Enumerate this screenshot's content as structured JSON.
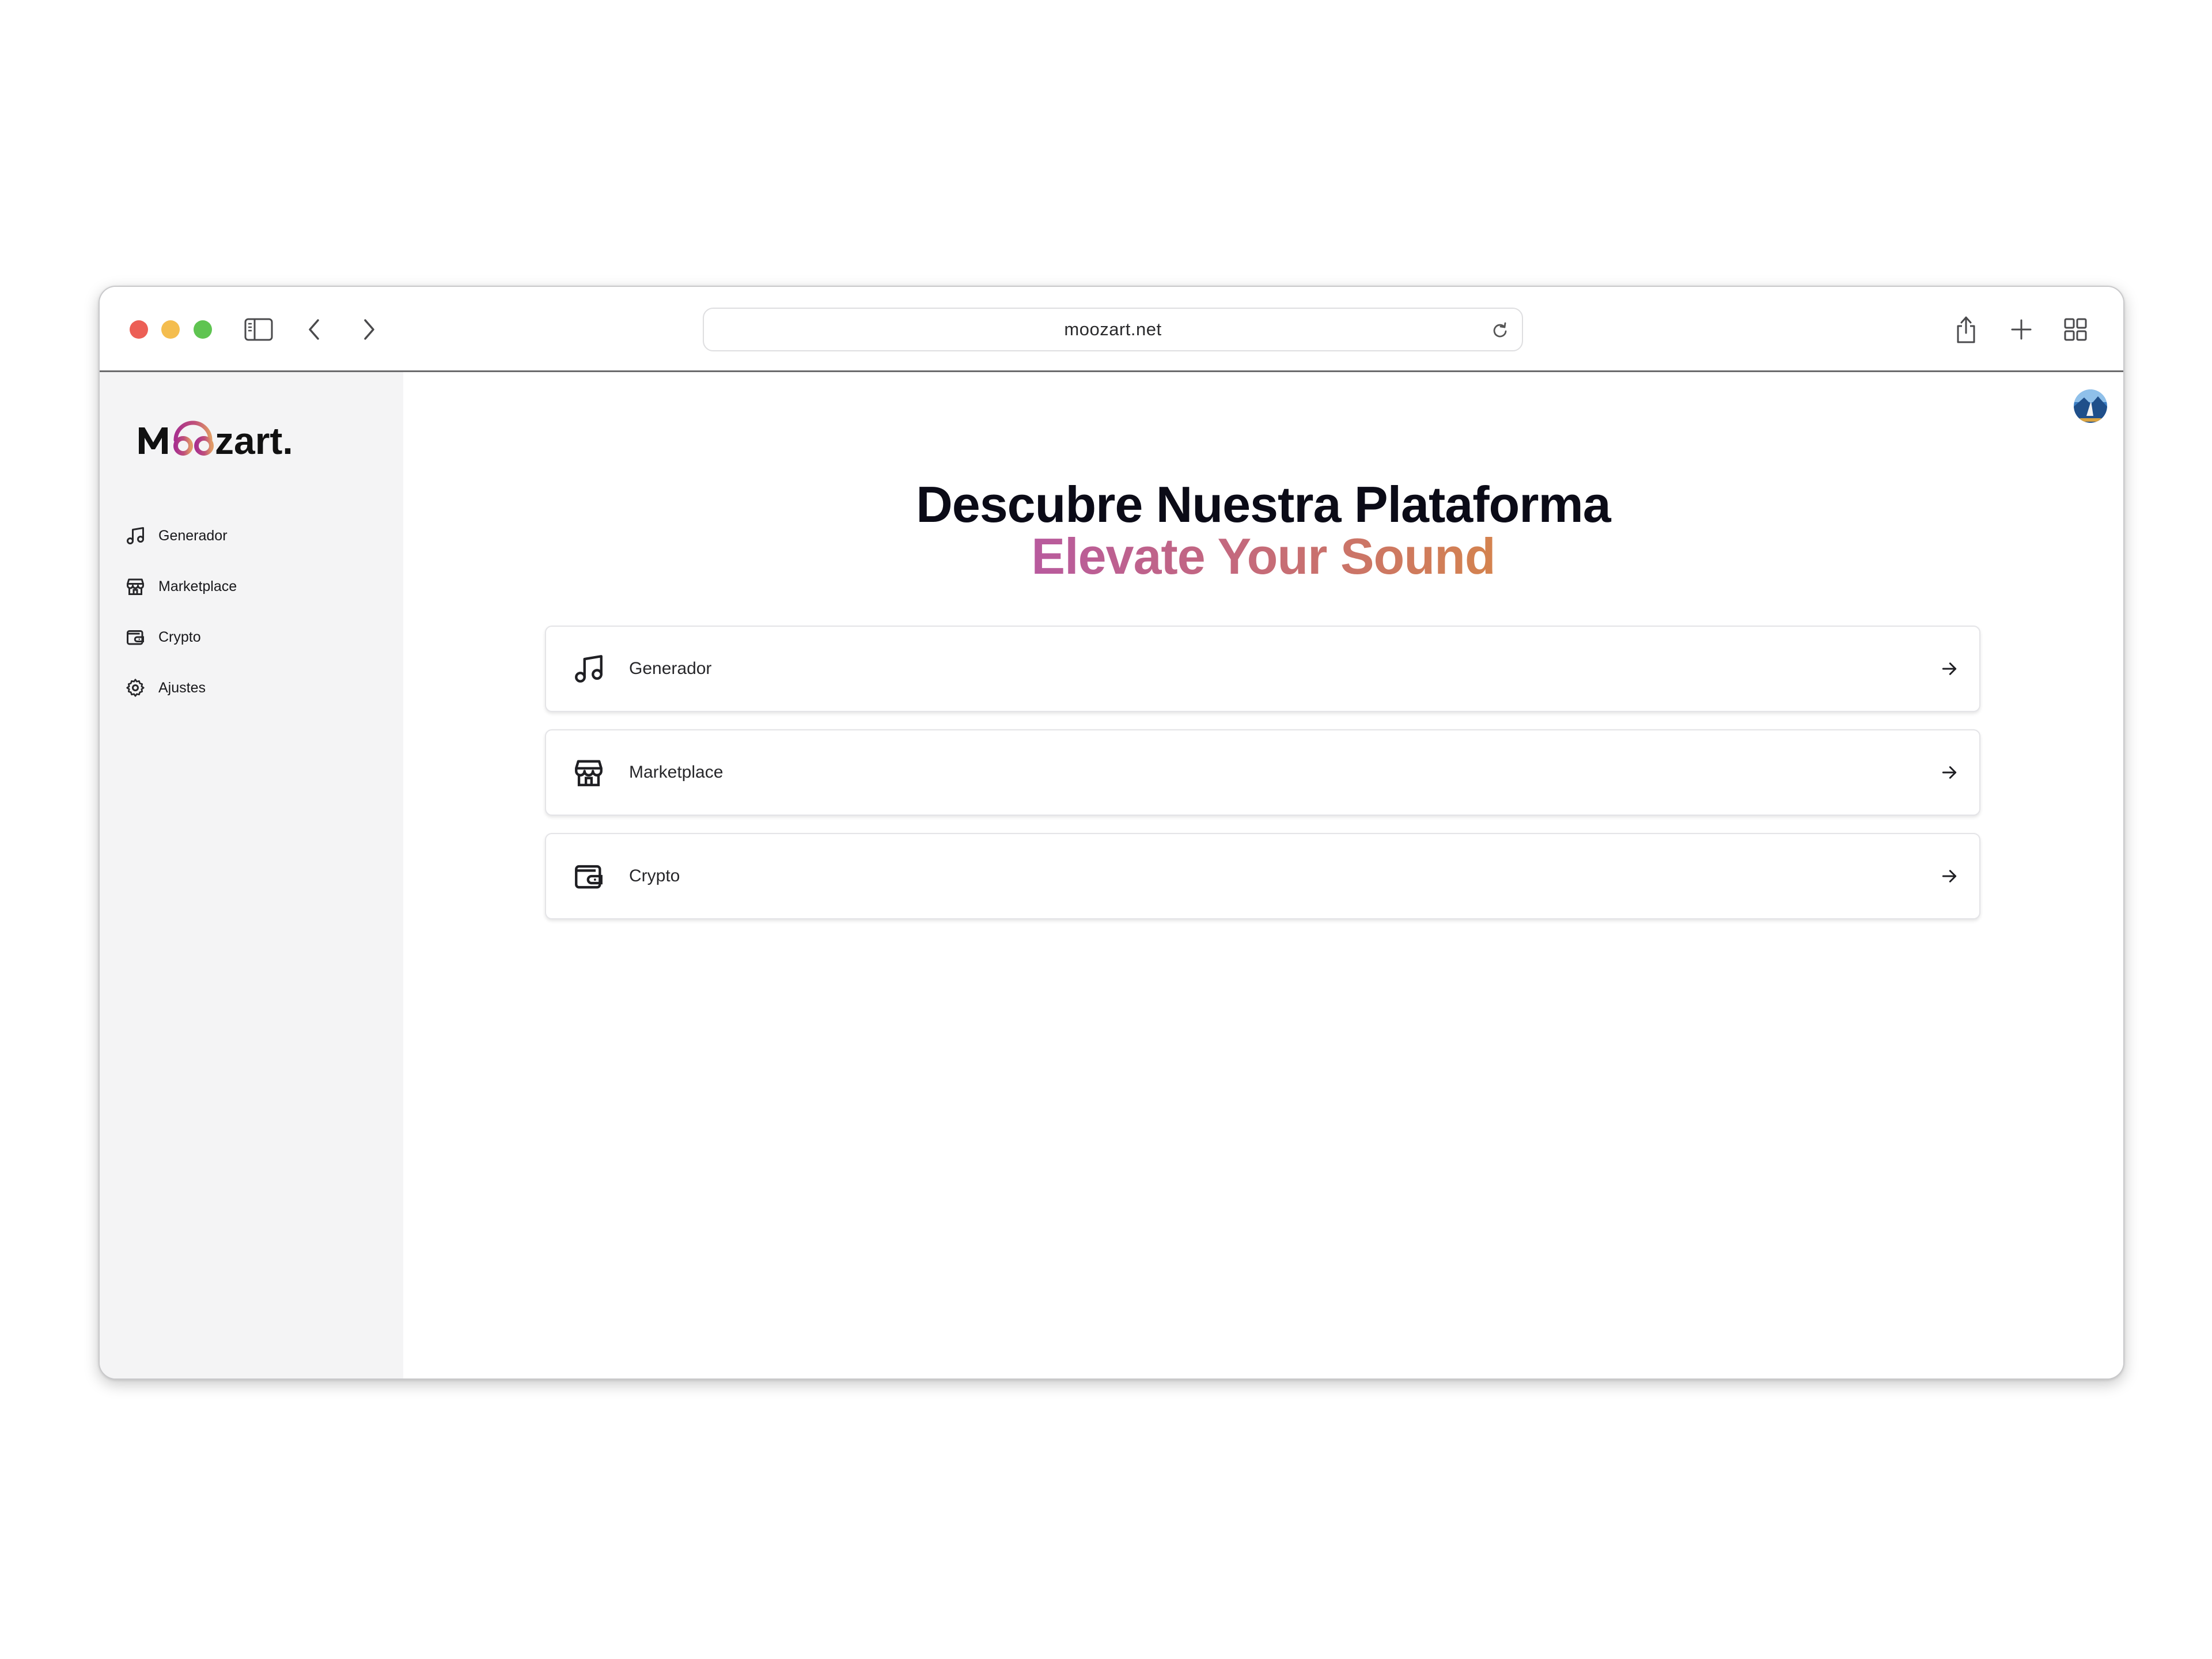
{
  "browser": {
    "url": "moozart.net"
  },
  "sidebar": {
    "logo_text": "Moozart.",
    "items": [
      {
        "label": "Generador",
        "icon": "music-note-icon"
      },
      {
        "label": "Marketplace",
        "icon": "store-icon"
      },
      {
        "label": "Crypto",
        "icon": "wallet-icon"
      },
      {
        "label": "Ajustes",
        "icon": "gear-icon"
      }
    ]
  },
  "main": {
    "title": "Descubre Nuestra Plataforma",
    "subtitle": "Elevate Your Sound",
    "cards": [
      {
        "label": "Generador",
        "icon": "music-note-icon"
      },
      {
        "label": "Marketplace",
        "icon": "store-icon"
      },
      {
        "label": "Crypto",
        "icon": "wallet-icon"
      }
    ]
  },
  "colors": {
    "gradient_start": "#b85a9e",
    "gradient_end": "#d4834e",
    "sidebar_bg": "#f4f4f5"
  }
}
